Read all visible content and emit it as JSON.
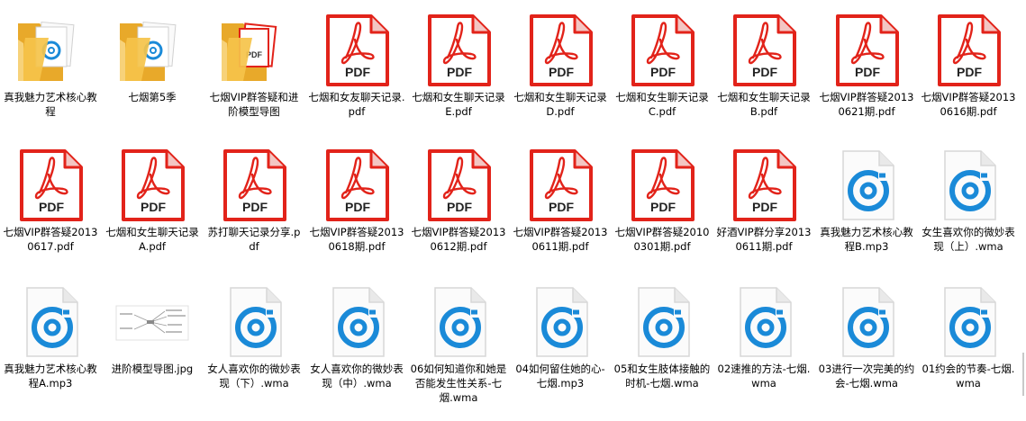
{
  "files": [
    {
      "name": "真我魅力艺术核心教程",
      "icon": "folder-icon"
    },
    {
      "name": "七烟第5季",
      "icon": "folder-icon"
    },
    {
      "name": "七烟VIP群答疑和进阶模型导图",
      "icon": "folder-pdf-icon"
    },
    {
      "name": "七烟和女友聊天记录.pdf",
      "icon": "pdf-icon"
    },
    {
      "name": "七烟和女生聊天记录E.pdf",
      "icon": "pdf-icon"
    },
    {
      "name": "七烟和女生聊天记录D.pdf",
      "icon": "pdf-icon"
    },
    {
      "name": "七烟和女生聊天记录C.pdf",
      "icon": "pdf-icon"
    },
    {
      "name": "七烟和女生聊天记录B.pdf",
      "icon": "pdf-icon"
    },
    {
      "name": "七烟VIP群答疑20130621期.pdf",
      "icon": "pdf-icon"
    },
    {
      "name": "七烟VIP群答疑20130616期.pdf",
      "icon": "pdf-icon"
    },
    {
      "name": "七烟VIP群答疑20130617.pdf",
      "icon": "pdf-icon"
    },
    {
      "name": "七烟和女生聊天记录A.pdf",
      "icon": "pdf-icon"
    },
    {
      "name": "苏打聊天记录分享.pdf",
      "icon": "pdf-icon"
    },
    {
      "name": "七烟VIP群答疑20130618期.pdf",
      "icon": "pdf-icon"
    },
    {
      "name": "七烟VIP群答疑20130612期.pdf",
      "icon": "pdf-icon"
    },
    {
      "name": "七烟VIP群答疑20130611期.pdf",
      "icon": "pdf-icon"
    },
    {
      "name": "七烟VIP群答疑20100301期.pdf",
      "icon": "pdf-icon"
    },
    {
      "name": "好酒VIP群分享20130611期.pdf",
      "icon": "pdf-icon"
    },
    {
      "name": "真我魅力艺术核心教程B.mp3",
      "icon": "audio-icon"
    },
    {
      "name": "女生喜欢你的微妙表现（上）.wma",
      "icon": "audio-icon"
    },
    {
      "name": "真我魅力艺术核心教程A.mp3",
      "icon": "audio-icon"
    },
    {
      "name": "进阶模型导图.jpg",
      "icon": "image-thumbnail-icon"
    },
    {
      "name": "女人喜欢你的微妙表现（下）.wma",
      "icon": "audio-icon"
    },
    {
      "name": "女人喜欢你的微妙表现（中）.wma",
      "icon": "audio-icon"
    },
    {
      "name": "06如何知道你和她是否能发生性关系-七烟.wma",
      "icon": "audio-icon"
    },
    {
      "name": "04如何留住她的心-七烟.mp3",
      "icon": "audio-icon"
    },
    {
      "name": "05和女生肢体接触的时机-七烟.wma",
      "icon": "audio-icon"
    },
    {
      "name": "02速推的方法-七烟.wma",
      "icon": "audio-icon"
    },
    {
      "name": "03进行一次完美的约会-七烟.wma",
      "icon": "audio-icon"
    },
    {
      "name": "01约会的节奏-七烟.wma",
      "icon": "audio-icon"
    }
  ],
  "icon_labels": {
    "pdf": "PDF"
  },
  "colors": {
    "pdf_red": "#e2231a",
    "audio_blue": "#1a8ad8",
    "folder_yellow": "#f5c34a"
  }
}
